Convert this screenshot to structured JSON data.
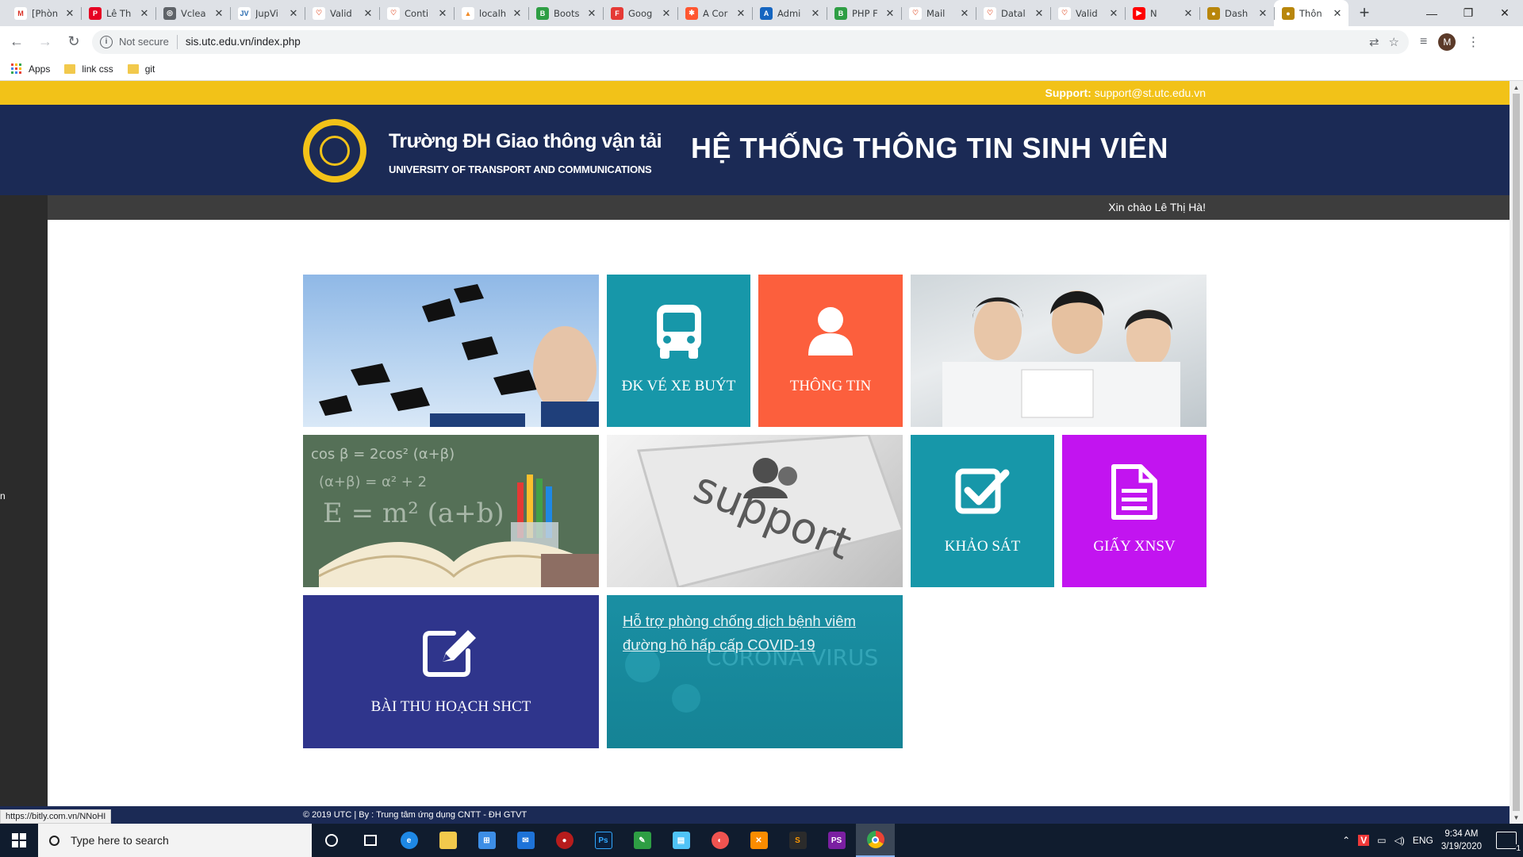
{
  "browser": {
    "tabs": [
      {
        "title": "[Phòn",
        "fav_color": "#ffffff",
        "fav_text": "M",
        "fav_fg": "#d93025"
      },
      {
        "title": "Lê Th",
        "fav_color": "#e60023",
        "fav_text": "P",
        "fav_fg": "#ffffff"
      },
      {
        "title": "Vclea",
        "fav_color": "#5f6368",
        "fav_text": "◎",
        "fav_fg": "#ffffff"
      },
      {
        "title": "JupVi",
        "fav_color": "#ffffff",
        "fav_text": "JV",
        "fav_fg": "#2b6cb0"
      },
      {
        "title": "Valid",
        "fav_color": "#ffffff",
        "fav_text": "♡",
        "fav_fg": "#e76f51"
      },
      {
        "title": "Conti",
        "fav_color": "#ffffff",
        "fav_text": "♡",
        "fav_fg": "#e76f51"
      },
      {
        "title": "localh",
        "fav_color": "#ffffff",
        "fav_text": "▲",
        "fav_fg": "#f28c28"
      },
      {
        "title": "Boots",
        "fav_color": "#2e9e44",
        "fav_text": "B",
        "fav_fg": "#ffffff"
      },
      {
        "title": "Goog",
        "fav_color": "#e53935",
        "fav_text": "F",
        "fav_fg": "#ffffff"
      },
      {
        "title": "A Cor",
        "fav_color": "#ff5630",
        "fav_text": "✱",
        "fav_fg": "#ffffff"
      },
      {
        "title": "Admi",
        "fav_color": "#1565c0",
        "fav_text": "A",
        "fav_fg": "#ffffff"
      },
      {
        "title": "PHP F",
        "fav_color": "#2e9e44",
        "fav_text": "B",
        "fav_fg": "#ffffff"
      },
      {
        "title": "Mail",
        "fav_color": "#ffffff",
        "fav_text": "♡",
        "fav_fg": "#e76f51"
      },
      {
        "title": "Datal",
        "fav_color": "#ffffff",
        "fav_text": "♡",
        "fav_fg": "#e76f51"
      },
      {
        "title": "Valid",
        "fav_color": "#ffffff",
        "fav_text": "♡",
        "fav_fg": "#e76f51"
      },
      {
        "title": "N",
        "fav_color": "#ff0000",
        "fav_text": "▶",
        "fav_fg": "#ffffff"
      },
      {
        "title": "Dash",
        "fav_color": "#b8860b",
        "fav_text": "●",
        "fav_fg": "#ffffff"
      },
      {
        "title": "Thôn",
        "fav_color": "#b8860b",
        "fav_text": "●",
        "fav_fg": "#ffffff",
        "active": true
      }
    ],
    "security_label": "Not secure",
    "url": "sis.utc.edu.vn/index.php",
    "profile_initial": "M",
    "bookmarks": [
      {
        "label": "Apps",
        "kind": "apps"
      },
      {
        "label": "link css",
        "kind": "folder"
      },
      {
        "label": "git",
        "kind": "folder"
      }
    ],
    "status_link": "https://bitly.com.vn/NNoHI"
  },
  "site": {
    "support_label": "Support:",
    "support_email": "support@st.utc.edu.vn",
    "university_vn": "Trường ĐH Giao thông vận tải",
    "university_en": "UNIVERSITY OF TRANSPORT AND COMMUNICATIONS",
    "system_title": "HỆ THỐNG THÔNG TIN SINH VIÊN",
    "greeting": "Xin chào Lê Thị Hà!",
    "sidebar_edge_text": "n",
    "footer_text": "© 2019 UTC | By : Trung tâm ứng dụng CNTT - ĐH GTVT",
    "colors": {
      "yellow": "#f2c218",
      "navy": "#1b2a55",
      "teal": "#1797a9",
      "orange": "#fc5f3d",
      "purple": "#c214f0",
      "indigo": "#2f358c"
    }
  },
  "tiles": {
    "bus": {
      "label": "ĐK VÉ XE BUÝT",
      "icon": "bus-icon"
    },
    "info": {
      "label": "THÔNG TIN",
      "icon": "user-icon"
    },
    "survey": {
      "label": "KHẢO SÁT",
      "icon": "checkbox-icon"
    },
    "certificate": {
      "label": "GIẤY XNSV",
      "icon": "document-icon"
    },
    "report": {
      "label": "BÀI THU HOẠCH SHCT",
      "icon": "edit-icon"
    },
    "covid_link": "Hỗ trợ phòng chống dịch bệnh viêm đường hô hấp cấp COVID-19",
    "covid_bg_text": "CORONA VIRUS",
    "support_key_text": "support"
  },
  "taskbar": {
    "search_placeholder": "Type here to search",
    "language": "ENG",
    "time": "9:34 AM",
    "date": "3/19/2020",
    "notification_count": "1"
  }
}
